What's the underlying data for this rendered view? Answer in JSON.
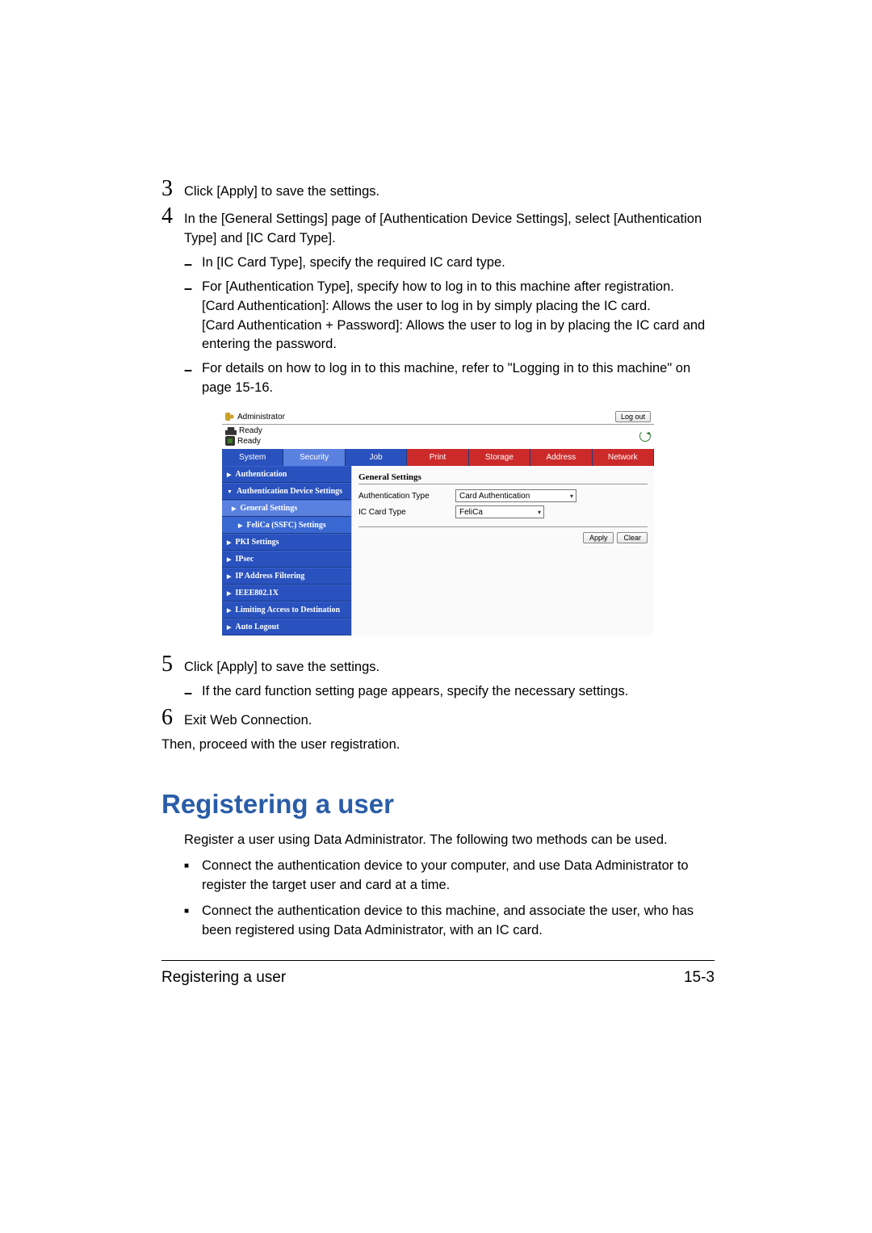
{
  "steps": {
    "s3": {
      "num": "3",
      "text": "Click [Apply] to save the settings."
    },
    "s4": {
      "num": "4",
      "text": "In the [General Settings] page of [Authentication Device Settings], select [Authentication Type] and [IC Card Type].",
      "subs": {
        "a": "In [IC Card Type], specify the required IC card type.",
        "b": "For [Authentication Type], specify how to log in to this machine after registration.\n[Card Authentication]: Allows the user to log in by simply placing the IC card.\n[Card Authentication + Password]: Allows the user to log in by placing the IC card and entering the password.",
        "c": "For details on how to log in to this machine, refer to \"Logging in to this machine\" on page 15-16."
      }
    },
    "s5": {
      "num": "5",
      "text": "Click [Apply] to save the settings.",
      "subs": {
        "a": "If the card function setting page appears, specify the necessary settings."
      }
    },
    "s6": {
      "num": "6",
      "text": "Exit Web Connection."
    },
    "after": "Then, proceed with the user registration."
  },
  "section": {
    "heading": "Registering a user",
    "intro": "Register a user using Data Administrator. The following two methods can be used.",
    "bullets": {
      "a": "Connect the authentication device to your computer, and use Data Administrator to register the target user and card at a time.",
      "b": "Connect the authentication device to this machine, and associate the user, who has been registered using Data Administrator, with an IC card."
    }
  },
  "footer": {
    "left": "Registering a user",
    "right": "15-3"
  },
  "screenshot": {
    "admin": "Administrator",
    "logout": "Log out",
    "ready": "Ready",
    "tabs": {
      "system": "System",
      "security": "Security",
      "job": "Job",
      "print": "Print",
      "storage": "Storage",
      "address": "Address",
      "network": "Network"
    },
    "side": {
      "auth": "Authentication",
      "ads": "Authentication Device Settings",
      "general": "General Settings",
      "felica": "FeliCa (SSFC) Settings",
      "pki": "PKI Settings",
      "ipsec": "IPsec",
      "ipfilter": "IP Address Filtering",
      "ieee": "IEEE802.1X",
      "limiting": "Limiting Access to Destination",
      "autol": "Auto Logout"
    },
    "panel": {
      "title": "General Settings",
      "authtype_label": "Authentication Type",
      "authtype_value": "Card Authentication",
      "iccard_label": "IC Card Type",
      "iccard_value": "FeliCa",
      "apply": "Apply",
      "clear": "Clear"
    }
  }
}
